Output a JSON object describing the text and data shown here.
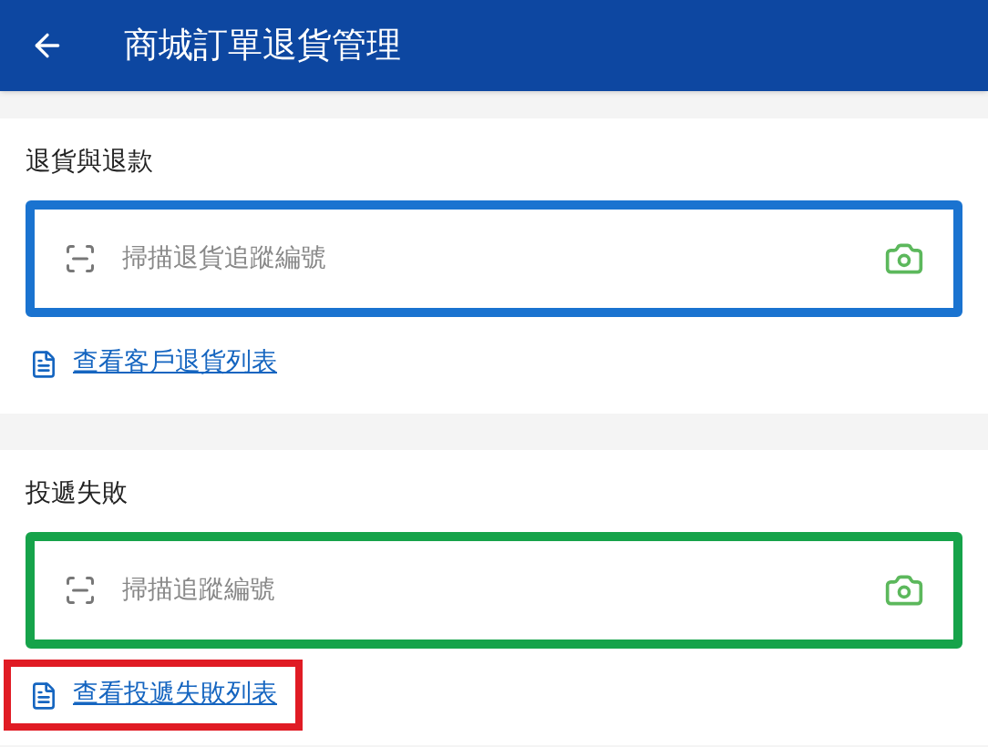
{
  "app_bar": {
    "title": "商城訂單退貨管理"
  },
  "sections": [
    {
      "title": "退貨與退款",
      "field": {
        "placeholder": "掃描退貨追蹤編號",
        "color": "#1a73d0"
      },
      "link": {
        "text": "查看客戶退貨列表"
      }
    },
    {
      "title": "投遞失敗",
      "field": {
        "placeholder": "掃描追蹤編號",
        "color": "#16a34a"
      },
      "link": {
        "text": "查看投遞失敗列表",
        "color": "#e01b24"
      }
    }
  ]
}
